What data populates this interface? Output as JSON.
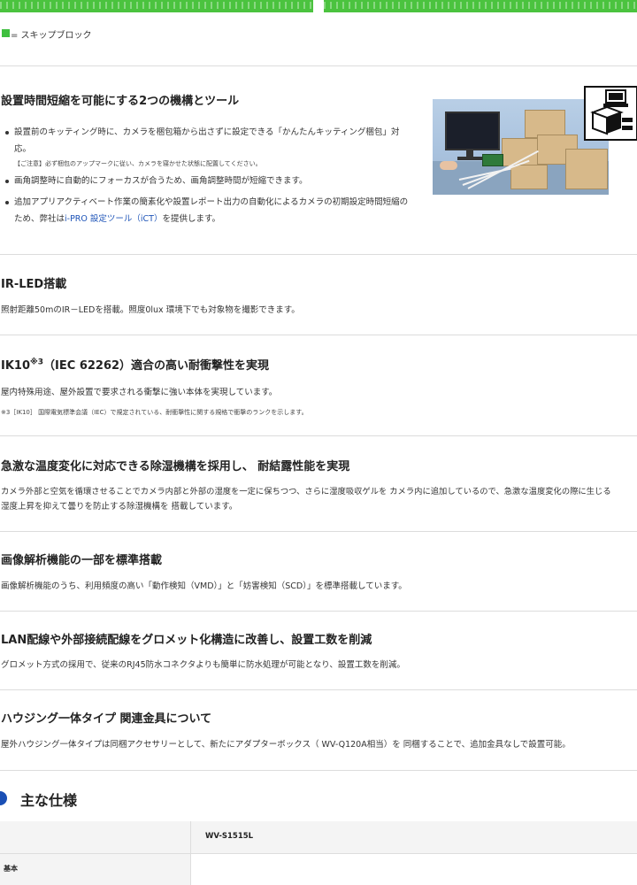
{
  "legend": {
    "text": "= スキップブロック",
    "swatch_color": "#3fbf3f"
  },
  "section1": {
    "heading": "設置時間短縮を可能にする2つの機構とツール",
    "bullet1_line1": "設置前のキッティング時に、カメラを梱包箱から出さずに設定できる「かんたんキッティング梱包」対",
    "bullet1_line2": "応。",
    "bullet1_caution": "【ご注意】必ず梱包のアップマークに従い、カメラを寝かせた状態に配置してください。",
    "bullet2": "画角調整時に自動的にフォーカスが合うため、画角調整時間が短縮できます。",
    "bullet3_line1": "追加アプリアクティベート作業の簡素化や設置レポート出力の自動化によるカメラの初期設定時間短縮の",
    "bullet3_line2_pre": "ため、弊社は",
    "bullet3_link": "i-PRO 設定ツール（iCT）",
    "bullet3_line2_post": "を提供します。",
    "photo_icon": "kitting-box-icon"
  },
  "section2": {
    "heading": "IR-LED搭載",
    "text": "照射距離50mのIR－LEDを搭載。照度0lux 環境下でも対象物を撮影できます。"
  },
  "section3": {
    "heading_pre": "IK10",
    "heading_sup": "※3",
    "heading_post": "（IEC 62262）適合の高い耐衝撃性を実現",
    "text": "屋内特殊用途、屋外設置で要求される衝撃に強い本体を実現しています。",
    "note": "※3［IK10］ 国際電気標準会議（IEC）で規定されている、耐衝撃性に関する規格で衝撃のランクを示します。"
  },
  "section4": {
    "heading": "急激な温度変化に対応できる除湿機構を採用し、 耐結露性能を実現",
    "text_line1": "カメラ外部と空気を循環させることでカメラ内部と外部の湿度を一定に保ちつつ、さらに湿度吸収ゲルを カメラ内に追加しているので、急激な温度変化の際に生じる",
    "text_line2": "湿度上昇を抑えて曇りを防止する除湿機構を 搭載しています。"
  },
  "section5": {
    "heading": "画像解析機能の一部を標準搭載",
    "text": "画像解析機能のうち、利用頻度の高い「動作検知（VMD）」と「妨害検知（SCD）」を標準搭載しています。"
  },
  "section6": {
    "heading": "LAN配線や外部接続配線をグロメット化構造に改善し、設置工数を削減",
    "text": "グロメット方式の採用で、従来のRJ45防水コネクタよりも簡単に防水処理が可能となり、設置工数を削減。"
  },
  "section7": {
    "heading": "ハウジング一体タイプ 関連金具について",
    "text": "屋外ハウジング一体タイプは同梱アクセサリーとして、新たにアダプターボックス（ WV-Q120A相当）を 同梱することで、追加金具なしで設置可能。"
  },
  "specs": {
    "title": "主な仕様",
    "model": "WV-S1515L",
    "row1_label": "基本"
  }
}
